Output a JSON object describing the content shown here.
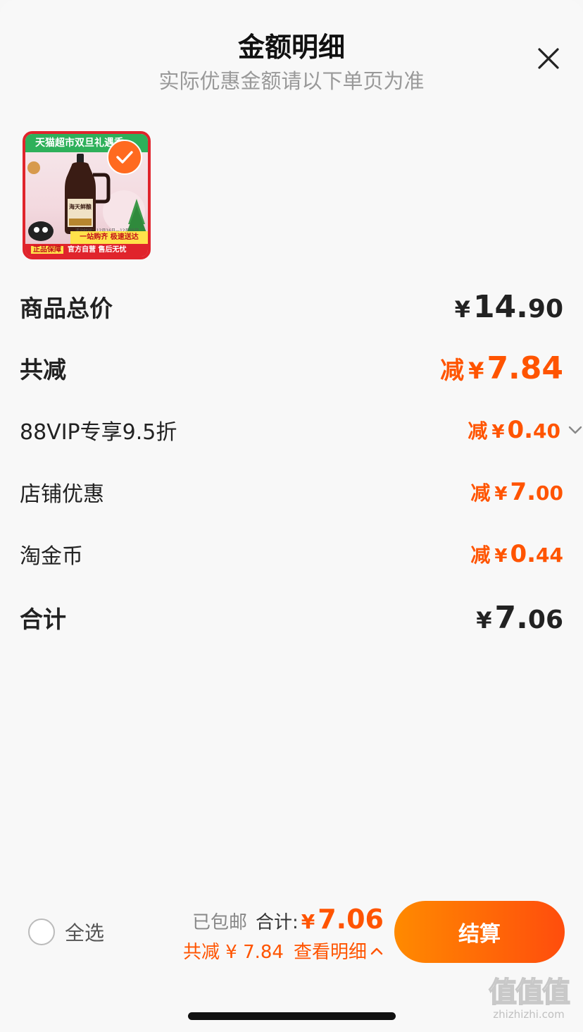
{
  "header": {
    "title": "金额明细",
    "subtitle": "实际优惠金额请以下单页为准"
  },
  "product": {
    "thumb_banner": "天猫超市双旦礼遇季",
    "thumb_brand": "海天鲜酿",
    "thumb_date": "活动时间：12月16日—12月25日",
    "thumb_yellow": "一站购齐 极速送达",
    "thumb_red_tag": "正品保障",
    "thumb_red_text": "官方自营 售后无忧",
    "selected": true
  },
  "rows": {
    "total_label": "商品总价",
    "total_yen": "¥",
    "total_int": "14.",
    "total_dec": "90",
    "discount_label": "共减",
    "discount_prefix": "减",
    "discount_yen": "¥",
    "discount_int": "7.84",
    "discount_dec": "",
    "vip_label": "88VIP专享9.5折",
    "vip_prefix": "减",
    "vip_yen": "¥",
    "vip_int": "0.",
    "vip_dec": "40",
    "shop_label": "店铺优惠",
    "shop_prefix": "减",
    "shop_yen": "¥",
    "shop_int": "7.",
    "shop_dec": "00",
    "coin_label": "淘金币",
    "coin_prefix": "减",
    "coin_yen": "¥",
    "coin_int": "0.",
    "coin_dec": "44",
    "sum_label": "合计",
    "sum_yen": "¥",
    "sum_int": "7.",
    "sum_dec": "06"
  },
  "footer": {
    "select_all": "全选",
    "shipped": "已包邮",
    "sum_label": "合计:",
    "sum_yen": "¥",
    "sum_value": "7.06",
    "discount_text": "共减 ¥ 7.84",
    "detail_link": "查看明细",
    "checkout": "结算"
  },
  "watermark": {
    "logo": "值值值",
    "url": "zhizhizhi.com"
  },
  "colors": {
    "accent": "#ff5400",
    "checkout_start": "#ff8a00",
    "checkout_end": "#ff4d0d"
  }
}
